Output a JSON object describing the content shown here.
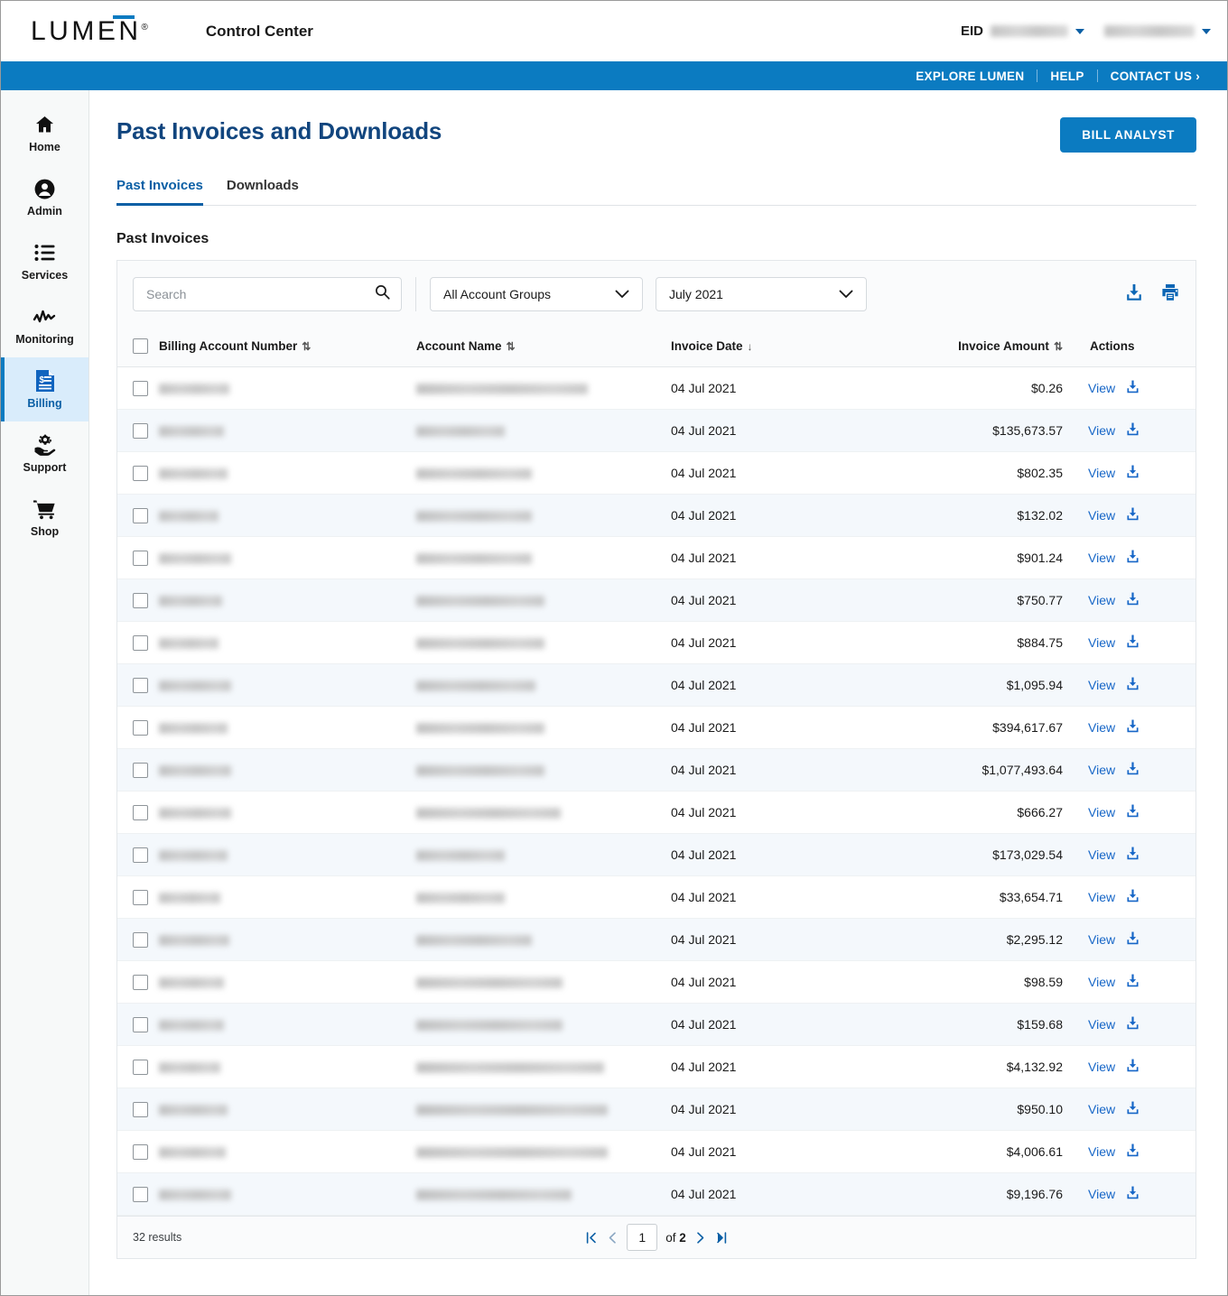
{
  "header": {
    "logo_text": "LUMEN",
    "logo_registered": "®",
    "app_title": "Control Center",
    "eid_label": "EID",
    "eid_value": "",
    "user_value": "",
    "nav": [
      {
        "label": "EXPLORE LUMEN"
      },
      {
        "label": "HELP"
      },
      {
        "label": "CONTACT US"
      }
    ],
    "contact_chevron": "›"
  },
  "sidebar": {
    "items": [
      {
        "label": "Home",
        "icon": "home-icon",
        "active": false
      },
      {
        "label": "Admin",
        "icon": "user-circle-icon",
        "active": false
      },
      {
        "label": "Services",
        "icon": "list-icon",
        "active": false
      },
      {
        "label": "Monitoring",
        "icon": "pulse-icon",
        "active": false
      },
      {
        "label": "Billing",
        "icon": "invoice-icon",
        "active": true
      },
      {
        "label": "Support",
        "icon": "support-hand-icon",
        "active": false
      },
      {
        "label": "Shop",
        "icon": "cart-icon",
        "active": false
      }
    ]
  },
  "page": {
    "title": "Past Invoices and Downloads",
    "primary_button": "BILL ANALYST",
    "tabs": [
      {
        "label": "Past Invoices",
        "active": true
      },
      {
        "label": "Downloads",
        "active": false
      }
    ],
    "section_title": "Past Invoices"
  },
  "toolbar": {
    "search_placeholder": "Search",
    "search_value": "",
    "account_group_value": "All Account Groups",
    "period_value": "July 2021",
    "download_icon": "download-icon",
    "print_icon": "print-icon"
  },
  "table": {
    "columns": [
      {
        "key": "checkbox",
        "label": ""
      },
      {
        "key": "ban",
        "label": "Billing Account Number",
        "sort": "⇅"
      },
      {
        "key": "name",
        "label": "Account Name",
        "sort": "⇅"
      },
      {
        "key": "date",
        "label": "Invoice Date",
        "sort": "↓"
      },
      {
        "key": "amount",
        "label": "Invoice Amount",
        "sort": "⇅"
      },
      {
        "key": "actions",
        "label": "Actions",
        "sort": ""
      }
    ],
    "action_label": "View",
    "action_icon": "download-icon",
    "rows": [
      {
        "ban_redacted_width": 78,
        "name_redacted_width": 190,
        "date": "04 Jul 2021",
        "amount": "$0.26"
      },
      {
        "ban_redacted_width": 72,
        "name_redacted_width": 98,
        "date": "04 Jul 2021",
        "amount": "$135,673.57"
      },
      {
        "ban_redacted_width": 76,
        "name_redacted_width": 128,
        "date": "04 Jul 2021",
        "amount": "$802.35"
      },
      {
        "ban_redacted_width": 66,
        "name_redacted_width": 128,
        "date": "04 Jul 2021",
        "amount": "$132.02"
      },
      {
        "ban_redacted_width": 80,
        "name_redacted_width": 128,
        "date": "04 Jul 2021",
        "amount": "$901.24"
      },
      {
        "ban_redacted_width": 70,
        "name_redacted_width": 142,
        "date": "04 Jul 2021",
        "amount": "$750.77"
      },
      {
        "ban_redacted_width": 66,
        "name_redacted_width": 142,
        "date": "04 Jul 2021",
        "amount": "$884.75"
      },
      {
        "ban_redacted_width": 80,
        "name_redacted_width": 132,
        "date": "04 Jul 2021",
        "amount": "$1,095.94"
      },
      {
        "ban_redacted_width": 76,
        "name_redacted_width": 142,
        "date": "04 Jul 2021",
        "amount": "$394,617.67"
      },
      {
        "ban_redacted_width": 80,
        "name_redacted_width": 142,
        "date": "04 Jul 2021",
        "amount": "$1,077,493.64"
      },
      {
        "ban_redacted_width": 80,
        "name_redacted_width": 160,
        "date": "04 Jul 2021",
        "amount": "$666.27"
      },
      {
        "ban_redacted_width": 76,
        "name_redacted_width": 98,
        "date": "04 Jul 2021",
        "amount": "$173,029.54"
      },
      {
        "ban_redacted_width": 68,
        "name_redacted_width": 98,
        "date": "04 Jul 2021",
        "amount": "$33,654.71"
      },
      {
        "ban_redacted_width": 78,
        "name_redacted_width": 128,
        "date": "04 Jul 2021",
        "amount": "$2,295.12"
      },
      {
        "ban_redacted_width": 72,
        "name_redacted_width": 162,
        "date": "04 Jul 2021",
        "amount": "$98.59"
      },
      {
        "ban_redacted_width": 72,
        "name_redacted_width": 162,
        "date": "04 Jul 2021",
        "amount": "$159.68"
      },
      {
        "ban_redacted_width": 68,
        "name_redacted_width": 208,
        "date": "04 Jul 2021",
        "amount": "$4,132.92"
      },
      {
        "ban_redacted_width": 76,
        "name_redacted_width": 212,
        "date": "04 Jul 2021",
        "amount": "$950.10"
      },
      {
        "ban_redacted_width": 74,
        "name_redacted_width": 212,
        "date": "04 Jul 2021",
        "amount": "$4,006.61"
      },
      {
        "ban_redacted_width": 80,
        "name_redacted_width": 172,
        "date": "04 Jul 2021",
        "amount": "$9,196.76"
      }
    ]
  },
  "footer": {
    "results_text": "32 results",
    "first_icon": "first-page-icon",
    "prev_icon": "previous-page-icon",
    "page_value": "1",
    "of_label": "of",
    "total_pages": "2",
    "next_icon": "next-page-icon",
    "last_icon": "last-page-icon"
  },
  "colors": {
    "brand_blue": "#0b7bc1",
    "title_navy": "#11457e",
    "link_blue": "#1666c7",
    "active_nav_bg": "#d9ecfb",
    "row_stripe": "#f4f8fc"
  }
}
